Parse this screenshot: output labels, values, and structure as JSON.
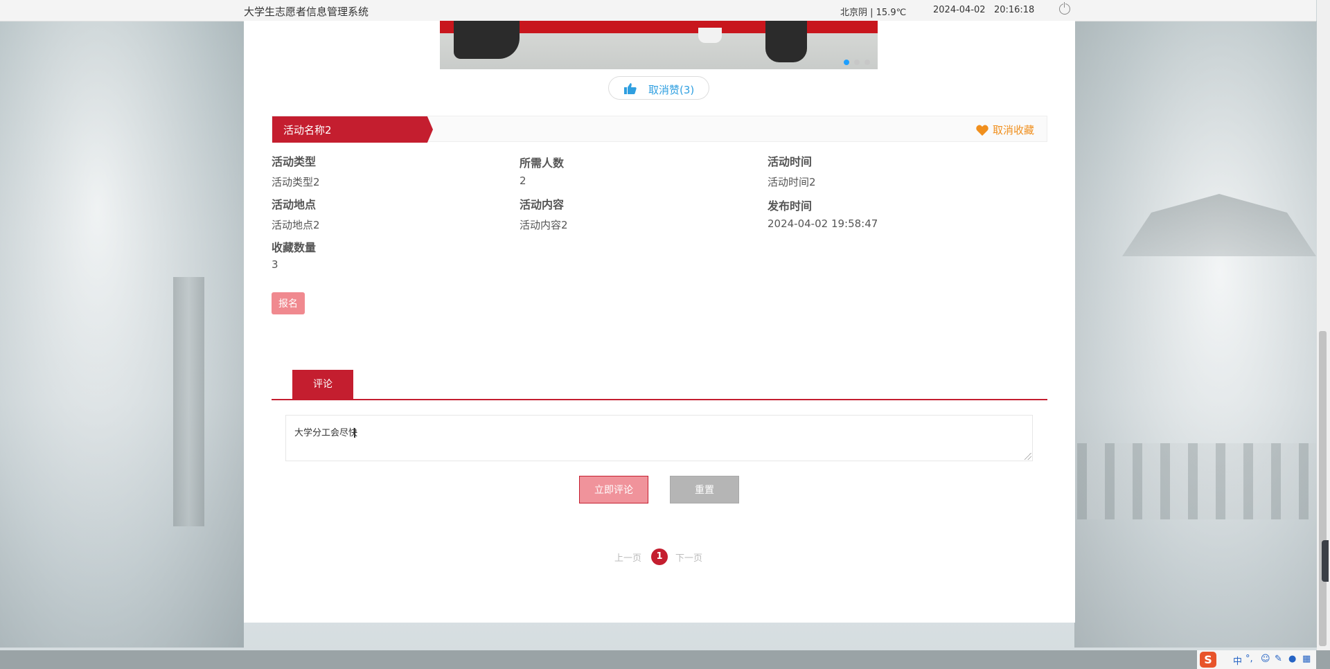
{
  "topbar": {
    "title": "大学生志愿者信息管理系统",
    "weather": "北京阴 | 15.9℃",
    "datetime": "2024-04-02   20:16:18"
  },
  "carousel": {
    "dot_count": 3,
    "active_index": 0
  },
  "like": {
    "label": "取消赞(3)"
  },
  "activity": {
    "name": "活动名称2",
    "favorite_label": "取消收藏",
    "fields": [
      {
        "label": "活动类型",
        "value": "活动类型2"
      },
      {
        "label": "所需人数",
        "value": "2"
      },
      {
        "label": "活动时间",
        "value": "活动时间2"
      },
      {
        "label": "活动地点",
        "value": "活动地点2"
      },
      {
        "label": "活动内容",
        "value": "活动内容2"
      },
      {
        "label": "发布时间",
        "value": "2024-04-02 19:58:47"
      },
      {
        "label": "收藏数量",
        "value": "3"
      }
    ],
    "signup_label": "报名"
  },
  "comments": {
    "tab_label": "评论",
    "input_value": "大学分工会尽快",
    "submit_label": "立即评论",
    "reset_label": "重置"
  },
  "pagination": {
    "prev_label": "上一页",
    "current": "1",
    "next_label": "下一页"
  },
  "ime": {
    "logo": "S",
    "lang": "中",
    "punct": "°,"
  },
  "colors": {
    "brand_red": "#c41e2f",
    "like_blue": "#2f9fe0",
    "favorite_orange": "#f08f1d",
    "signup_pink": "#f0898f"
  }
}
